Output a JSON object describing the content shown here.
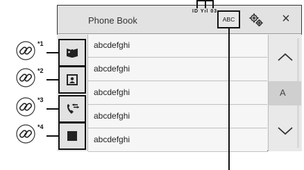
{
  "header": {
    "title": "Phone Book",
    "status": "ID Yıl 03",
    "abc_label": "ABC",
    "close_glyph": "×"
  },
  "sidebar": {
    "buttons": [
      {
        "name": "phonebook-icon",
        "marker": "*1"
      },
      {
        "name": "contact-card-icon",
        "marker": "*2"
      },
      {
        "name": "call-history-icon",
        "marker": "*3"
      },
      {
        "name": "square-icon",
        "marker": "*4"
      }
    ]
  },
  "contacts": [
    "abcdefghi",
    "abcdefghi",
    "abcdefghi",
    "abcdefghi",
    "abcdefghi"
  ],
  "scroll": {
    "up_glyph": "︿",
    "down_glyph": "﹀",
    "letter": "A"
  },
  "colors": {
    "header_bg": "#e2e2e2",
    "row_bg": "#f6f6f6",
    "border": "#111111"
  }
}
